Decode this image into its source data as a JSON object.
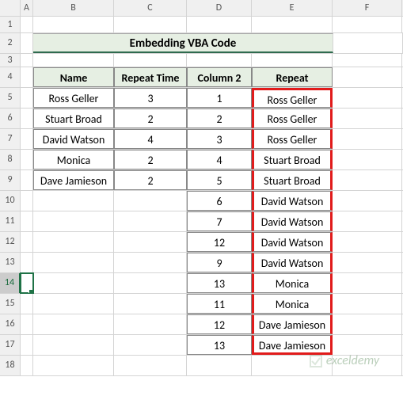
{
  "columns": [
    "A",
    "B",
    "C",
    "D",
    "E",
    "F"
  ],
  "row_count": 18,
  "title": "Embedding VBA Code",
  "headers": {
    "name": "Name",
    "repeat_time": "Repeat Time",
    "col2": "Column 2",
    "repeat": "Repeat"
  },
  "table1": [
    {
      "name": "Ross Geller",
      "repeat_time": "3"
    },
    {
      "name": "Stuart Broad",
      "repeat_time": "2"
    },
    {
      "name": "David Watson",
      "repeat_time": "4"
    },
    {
      "name": "Monica",
      "repeat_time": "2"
    },
    {
      "name": "Dave Jamieson",
      "repeat_time": "2"
    }
  ],
  "column2": [
    "1",
    "2",
    "3",
    "4",
    "5",
    "6",
    "7",
    "12",
    "9",
    "13",
    "11",
    "12",
    "13"
  ],
  "repeat": [
    "Ross Geller",
    "Ross Geller",
    "Ross Geller",
    "Stuart Broad",
    "Stuart Broad",
    "David Watson",
    "David Watson",
    "David Watson",
    "David Watson",
    "Monica",
    "Monica",
    "Dave Jamieson",
    "Dave Jamieson"
  ],
  "watermark": "exceldemy",
  "selected_cell": "A14",
  "highlight_column": "E"
}
